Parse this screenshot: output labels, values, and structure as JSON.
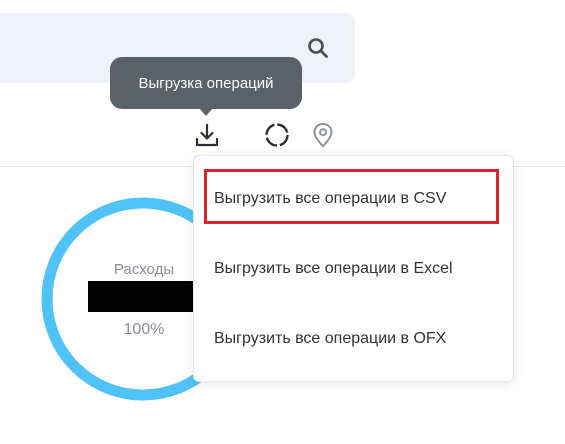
{
  "search": {
    "icon": "search-icon"
  },
  "tooltip": {
    "text": "Выгрузка операций"
  },
  "toolbar": {
    "icons": [
      "download-icon",
      "spinner-icon",
      "location-pin-icon"
    ]
  },
  "chart": {
    "label": "Расходы",
    "percent": "100%",
    "fill_fraction": 1.0,
    "color": "#4fc3f7"
  },
  "export_menu": {
    "items": [
      {
        "label": "Выгрузить все операции в CSV"
      },
      {
        "label": "Выгрузить все операции в Excel"
      },
      {
        "label": "Выгрузить все операции в OFX"
      }
    ]
  },
  "colors": {
    "tooltip_bg": "#5c6168",
    "highlight": "#e0232a",
    "search_bg": "#eef1f5"
  }
}
